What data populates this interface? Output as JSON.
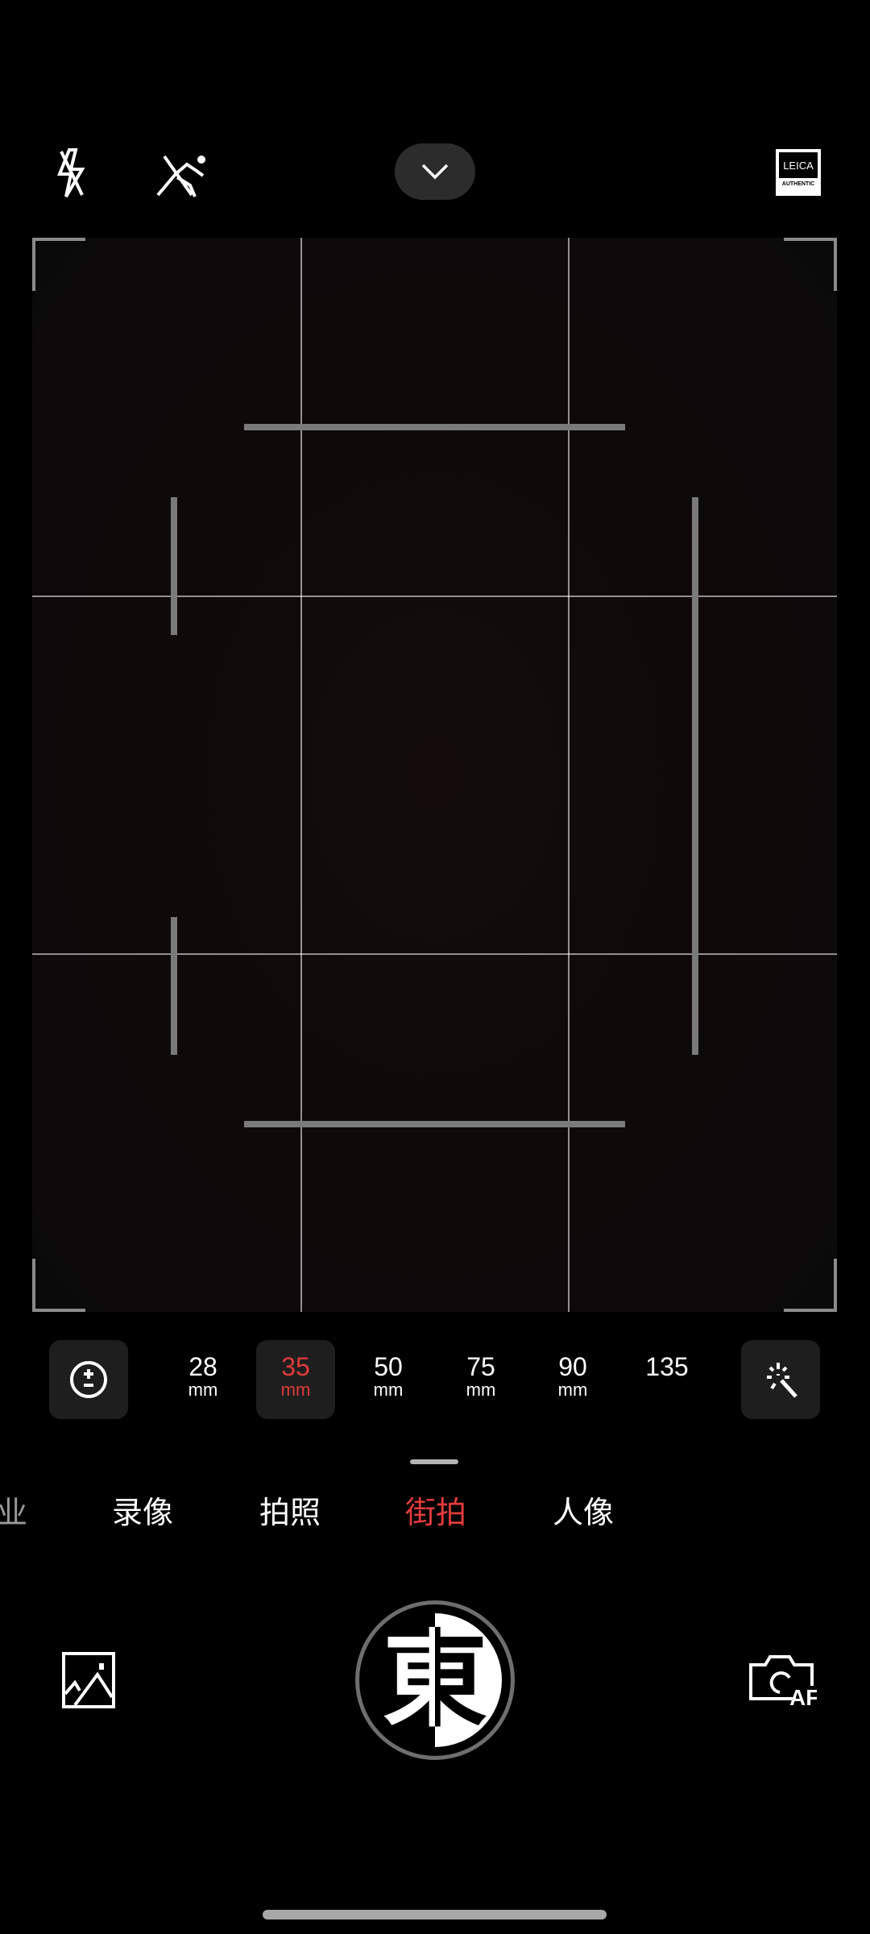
{
  "top_bar": {
    "flash_icon": "flash-off-icon",
    "motion_icon": "motion-capture-off-icon",
    "expand_icon": "chevron-down-icon",
    "badge": {
      "line1": "LEICA",
      "line2": "AUTHENTIC"
    }
  },
  "focal_lengths": [
    {
      "value": "28",
      "unit": "mm"
    },
    {
      "value": "35",
      "unit": "mm"
    },
    {
      "value": "50",
      "unit": "mm"
    },
    {
      "value": "75",
      "unit": "mm"
    },
    {
      "value": "90",
      "unit": "mm"
    },
    {
      "value": "135",
      "unit": ""
    }
  ],
  "selected_focal": "35",
  "modes": [
    "业",
    "录像",
    "拍照",
    "街拍",
    "人像"
  ],
  "selected_mode": "街拍",
  "shutter": {
    "glyph": "東"
  },
  "colors": {
    "accent": "#e23b3b",
    "background": "#000000",
    "button_bg": "#1e1e1e"
  }
}
